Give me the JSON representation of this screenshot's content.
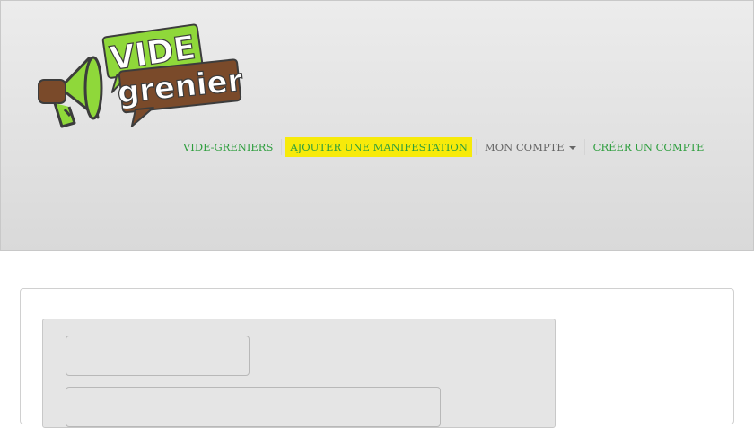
{
  "brand": {
    "word1": "VIDE",
    "word2": "grenier",
    "colors": {
      "green": "#8fd83a",
      "brown": "#7a4a2a",
      "megaphone_gray": "#3c3c3c"
    }
  },
  "nav": {
    "items": [
      {
        "label": "VIDE-GRENIERS",
        "style": "link"
      },
      {
        "label": "AJOUTER UNE MANIFESTATION",
        "style": "highlight"
      },
      {
        "label": "MON COMPTE",
        "style": "muted",
        "dropdown": true,
        "icon": "caret-down-icon"
      },
      {
        "label": "CRÉER UN COMPTE",
        "style": "link"
      }
    ],
    "colors": {
      "link": "#2e9e3e",
      "highlight_bg": "#f7ea0a",
      "muted": "#666666"
    }
  },
  "form": {
    "field1": {
      "value": "",
      "placeholder": ""
    },
    "field2": {
      "value": "",
      "placeholder": ""
    }
  }
}
